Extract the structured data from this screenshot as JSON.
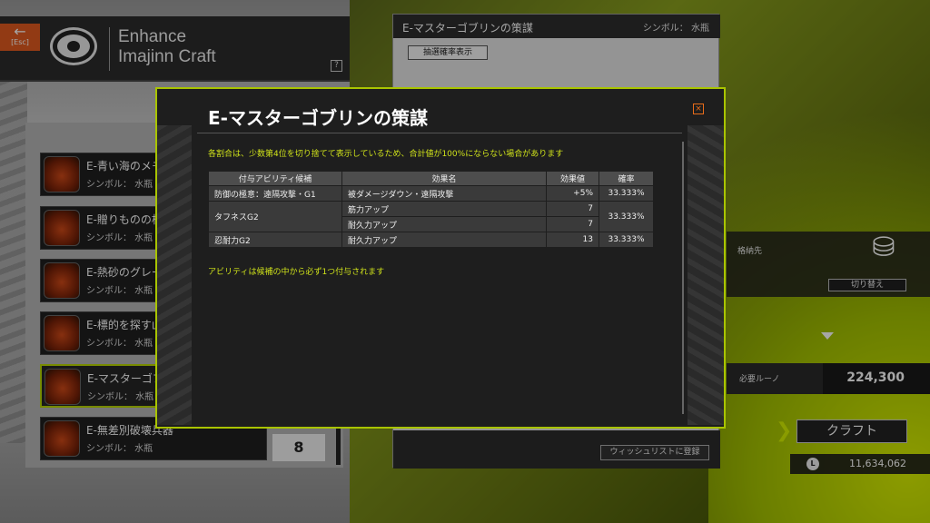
{
  "header": {
    "back_label": "[Esc]",
    "title_line1": "Enhance",
    "title_line2": "Imajinn Craft",
    "help_label": "?"
  },
  "list": {
    "items": [
      {
        "name": "E-青い海のメモ",
        "symbol": "シンボル：  水瓶"
      },
      {
        "name": "E-贈りものの相",
        "symbol": "シンボル：  水瓶"
      },
      {
        "name": "E-熱砂のグレー",
        "symbol": "シンボル：  水瓶"
      },
      {
        "name": "E-標的を探す山",
        "symbol": "シンボル：  水瓶"
      },
      {
        "name": "E-マスターゴブ",
        "symbol": "シンボル：  水瓶"
      },
      {
        "name": "E-無差別破壊兵器",
        "symbol": "シンボル：  水瓶"
      }
    ],
    "quantity": "8"
  },
  "right_panel": {
    "title": "E-マスターゴブリンの策謀",
    "symbol": "シンボル：  水瓶",
    "rate_button": "抽選確率表示",
    "wishlist_button": "ウィッシュリストに登録"
  },
  "storage": {
    "label": "格納先",
    "switch_button": "切り替え"
  },
  "rune": {
    "label": "必要ルーノ",
    "value": "224,300"
  },
  "craft": {
    "label": "クラフト"
  },
  "money": {
    "coin": "L",
    "value": "11,634,062"
  },
  "dialog": {
    "title": "E-マスターゴブリンの策謀",
    "close": "×",
    "note": "各割合は、少数第4位を切り捨てて表示しているため、合計値が100%にならない場合があります",
    "columns": [
      "付与アビリティ候補",
      "効果名",
      "効果値",
      "確率"
    ],
    "rows": [
      {
        "ability": "防御の極意：遠隔攻撃・G1",
        "effects": [
          {
            "name": "被ダメージダウン・遠隔攻撃",
            "value": "+5%"
          }
        ],
        "rate": "33.333%"
      },
      {
        "ability": "タフネスG2",
        "effects": [
          {
            "name": "筋力アップ",
            "value": "7"
          },
          {
            "name": "耐久力アップ",
            "value": "7"
          }
        ],
        "rate": "33.333%"
      },
      {
        "ability": "忍耐力G2",
        "effects": [
          {
            "name": "耐久力アップ",
            "value": "13"
          }
        ],
        "rate": "33.333%"
      }
    ],
    "footer": "アビリティは候補の中から必ず1つ付与されます"
  }
}
